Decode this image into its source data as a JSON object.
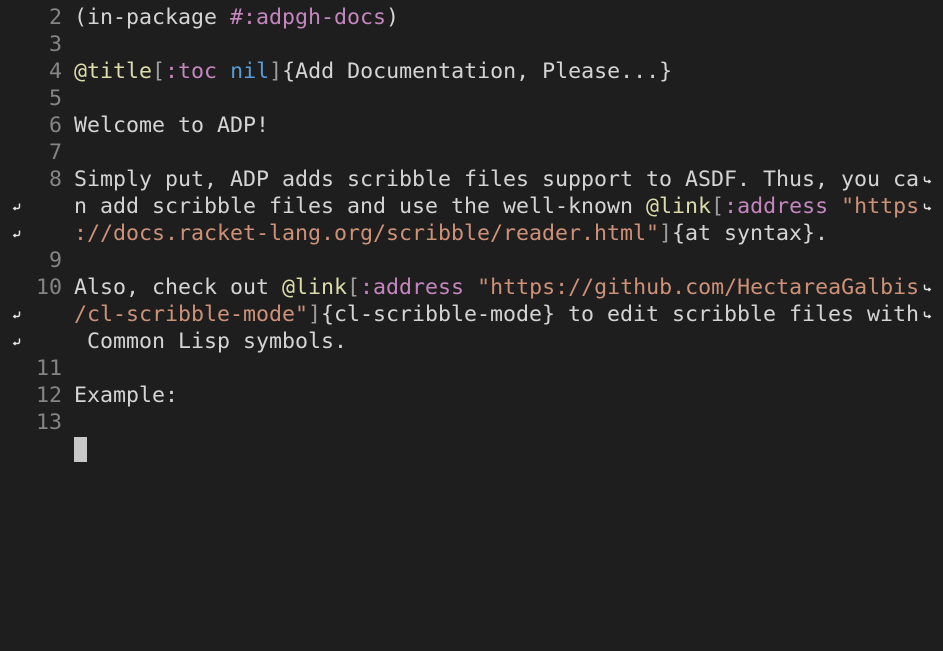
{
  "colors": {
    "background": "#1e1e1e",
    "text": "#d4d4d4",
    "line_number": "#858585",
    "at_command": "#dcdcaa",
    "keyword": "#c586c0",
    "constant": "#569cd6",
    "string": "#ce9178",
    "bracket": "#9d9d9d",
    "fringe_icon": "#e0e0e0"
  },
  "editor": {
    "lines": [
      {
        "number": "2",
        "segments": [
          {
            "text": "(in-package ",
            "style": "text"
          },
          {
            "text": "#:adpgh-docs",
            "style": "keyword"
          },
          {
            "text": ")",
            "style": "text"
          }
        ]
      },
      {
        "number": "3",
        "segments": []
      },
      {
        "number": "4",
        "segments": [
          {
            "text": "@title",
            "style": "at_command"
          },
          {
            "text": "[",
            "style": "bracket"
          },
          {
            "text": ":toc",
            "style": "keyword"
          },
          {
            "text": " ",
            "style": "text"
          },
          {
            "text": "nil",
            "style": "constant"
          },
          {
            "text": "]",
            "style": "bracket"
          },
          {
            "text": "{Add Documentation, Please...}",
            "style": "text"
          }
        ]
      },
      {
        "number": "5",
        "segments": []
      },
      {
        "number": "6",
        "segments": [
          {
            "text": "Welcome to ADP!",
            "style": "text"
          }
        ]
      },
      {
        "number": "7",
        "segments": []
      },
      {
        "number": "8",
        "segments": [
          {
            "text": "Simply put, ADP adds scribble files support to ASDF. Thus, you ca",
            "style": "text"
          }
        ],
        "wrap_right": true
      },
      {
        "number": "",
        "segments": [
          {
            "text": "n add scribble files and use the well-known ",
            "style": "text"
          },
          {
            "text": "@link",
            "style": "at_command"
          },
          {
            "text": "[",
            "style": "bracket"
          },
          {
            "text": ":address",
            "style": "keyword"
          },
          {
            "text": " ",
            "style": "text"
          },
          {
            "text": "\"https",
            "style": "string"
          }
        ],
        "wrap_left": true,
        "wrap_right": true
      },
      {
        "number": "",
        "segments": [
          {
            "text": "://docs.racket-lang.org/scribble/reader.html\"",
            "style": "string"
          },
          {
            "text": "]",
            "style": "bracket"
          },
          {
            "text": "{at syntax}.",
            "style": "text"
          }
        ],
        "wrap_left": true
      },
      {
        "number": "9",
        "segments": []
      },
      {
        "number": "10",
        "segments": [
          {
            "text": "Also, check out ",
            "style": "text"
          },
          {
            "text": "@link",
            "style": "at_command"
          },
          {
            "text": "[",
            "style": "bracket"
          },
          {
            "text": ":address",
            "style": "keyword"
          },
          {
            "text": " ",
            "style": "text"
          },
          {
            "text": "\"https://github.com/HectareaGalbis",
            "style": "string"
          }
        ],
        "wrap_right": true
      },
      {
        "number": "",
        "segments": [
          {
            "text": "/cl-scribble-mode\"",
            "style": "string"
          },
          {
            "text": "]",
            "style": "bracket"
          },
          {
            "text": "{cl-scribble-mode} to edit scribble files with",
            "style": "text"
          }
        ],
        "wrap_left": true,
        "wrap_right": true
      },
      {
        "number": "",
        "segments": [
          {
            "text": " Common Lisp symbols.",
            "style": "text"
          }
        ],
        "wrap_left": true
      },
      {
        "number": "11",
        "segments": []
      },
      {
        "number": "12",
        "segments": [
          {
            "text": "Example:",
            "style": "text"
          }
        ]
      },
      {
        "number": "13",
        "segments": []
      }
    ]
  }
}
